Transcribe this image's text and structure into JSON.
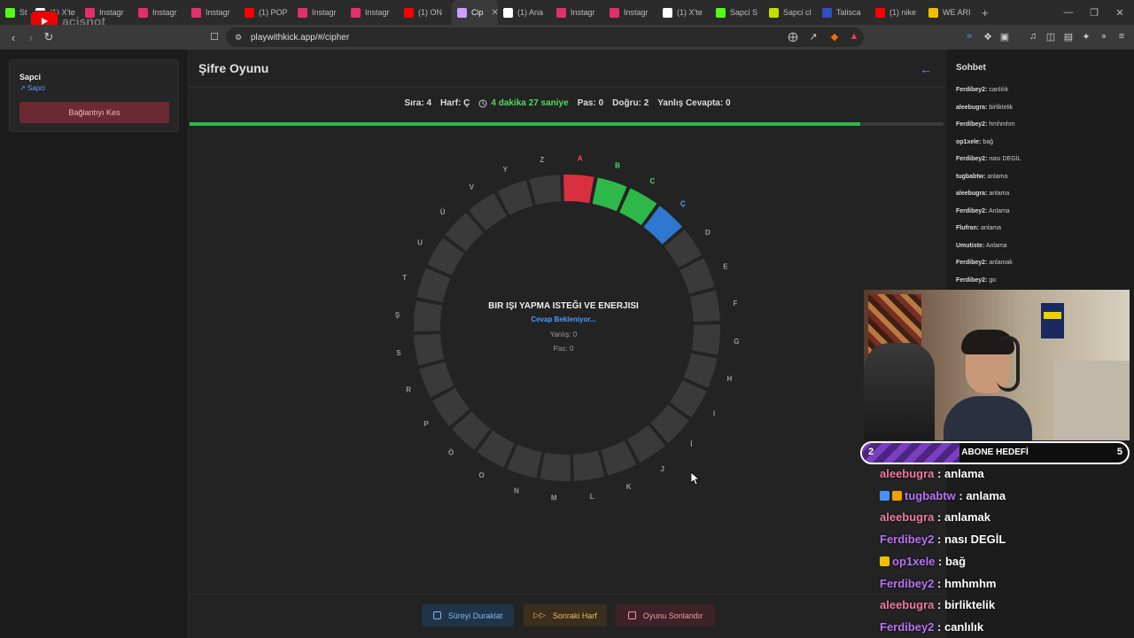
{
  "tabs": [
    {
      "label": "St",
      "icon": "kick-icon",
      "color": "#53fc18",
      "active": false
    },
    {
      "label": "(1) X'te",
      "icon": "x-icon",
      "color": "#ffffff",
      "active": false
    },
    {
      "label": "Instagr",
      "icon": "instagram-icon",
      "color": "#e1306c",
      "active": false
    },
    {
      "label": "Instagr",
      "icon": "instagram-icon",
      "color": "#e1306c",
      "active": false
    },
    {
      "label": "Instagr",
      "icon": "instagram-icon",
      "color": "#e1306c",
      "active": false
    },
    {
      "label": "(1) POP",
      "icon": "youtube-icon",
      "color": "#ff0000",
      "active": false
    },
    {
      "label": "Instagr",
      "icon": "instagram-icon",
      "color": "#e1306c",
      "active": false
    },
    {
      "label": "Instagr",
      "icon": "instagram-icon",
      "color": "#e1306c",
      "active": false
    },
    {
      "label": "(1) ON",
      "icon": "youtube-icon",
      "color": "#ff0000",
      "active": false
    },
    {
      "label": "Cip",
      "icon": "cipher-icon",
      "color": "#c9a0ff",
      "active": true
    },
    {
      "label": "(1) Ana",
      "icon": "x-icon",
      "color": "#ffffff",
      "active": false
    },
    {
      "label": "Instagr",
      "icon": "instagram-icon",
      "color": "#e1306c",
      "active": false
    },
    {
      "label": "Instagr",
      "icon": "instagram-icon",
      "color": "#e1306c",
      "active": false
    },
    {
      "label": "(1) X'te",
      "icon": "x-icon",
      "color": "#ffffff",
      "active": false
    },
    {
      "label": "Sapci S",
      "icon": "kick-icon",
      "color": "#53fc18",
      "active": false
    },
    {
      "label": "Sapci cl",
      "icon": "kick-icon",
      "color": "#c0e000",
      "active": false
    },
    {
      "label": "Talisca",
      "icon": "flag-icon",
      "color": "#3050c0",
      "active": false
    },
    {
      "label": "(1) nike",
      "icon": "youtube-icon",
      "color": "#ff0000",
      "active": false
    },
    {
      "label": "WE ARI",
      "icon": "crown-icon",
      "color": "#f0c000",
      "active": false
    }
  ],
  "watermark": "acisnot",
  "url": "playwithkick.app/#/cipher",
  "sidebar": {
    "user_name": "Sapci",
    "user_sub": "↗ Sapci",
    "disconnect_label": "Bağlantıyı Kes"
  },
  "game": {
    "title": "Şifre Oyunu",
    "stats": {
      "turn": "Sıra: 4",
      "letter": "Harf: Ç",
      "time": "4 dakika 27 saniye",
      "pass": "Pas: 0",
      "correct": "Doğru: 2",
      "wrong_answer": "Yanlış Cevapta: 0"
    },
    "progress": 0.89,
    "center": {
      "question": "BIR IŞI YAPMA ISTEĞI VE ENERJISI",
      "status": "Cevap Bekleniyor...",
      "wrong": "Yanlış: 0",
      "pass": "Pas: 0"
    },
    "letters": [
      "A",
      "B",
      "C",
      "Ç",
      "D",
      "E",
      "F",
      "G",
      "H",
      "I",
      "İ",
      "J",
      "K",
      "L",
      "M",
      "N",
      "O",
      "Ö",
      "P",
      "R",
      "S",
      "Ş",
      "T",
      "U",
      "Ü",
      "V",
      "Y",
      "Z"
    ],
    "letter_states": [
      "wrong",
      "correct",
      "correct",
      "current",
      "none",
      "none",
      "none",
      "none",
      "none",
      "none",
      "none",
      "none",
      "none",
      "none",
      "none",
      "none",
      "none",
      "none",
      "none",
      "none",
      "none",
      "none",
      "none",
      "none",
      "none",
      "none",
      "none",
      "none"
    ],
    "colors": {
      "wrong": "#d9303f",
      "correct": "#2fb84a",
      "current": "#2f78d0",
      "none": "#3a3a3a"
    },
    "buttons": {
      "pause": "Süreyi Duraklat",
      "next": "Sonraki Harf",
      "end": "Oyunu Sonlandır"
    }
  },
  "chat": {
    "title": "Sohbet",
    "messages": [
      {
        "user": "Ferdibey2:",
        "text": "canlılık"
      },
      {
        "user": "aleebugra:",
        "text": "birliktelik"
      },
      {
        "user": "Ferdibey2:",
        "text": "hmhmhm"
      },
      {
        "user": "op1xele:",
        "text": "bağ"
      },
      {
        "user": "Ferdibey2:",
        "text": "nası DEGİL"
      },
      {
        "user": "tugbabtw:",
        "text": "anlama"
      },
      {
        "user": "aleebugra:",
        "text": "anlama"
      },
      {
        "user": "Ferdibey2:",
        "text": "Anlama"
      },
      {
        "user": "Flufran:",
        "text": "anlama"
      },
      {
        "user": "Umutiste:",
        "text": "Anlama"
      },
      {
        "user": "Ferdibey2:",
        "text": "anlamak"
      },
      {
        "user": "Ferdibey2:",
        "text": "go"
      }
    ]
  },
  "overlay": {
    "goal_left": "2",
    "goal_label": "ABONE HEDEFİ",
    "goal_right": "5",
    "messages": [
      {
        "user": "aleebugra",
        "text": " : anlama",
        "color": "pink",
        "badges": []
      },
      {
        "user": "tugbabtw",
        "text": " : anlama",
        "color": "purple",
        "badges": [
          "#4a8fff",
          "#f0a000"
        ]
      },
      {
        "user": "aleebugra",
        "text": " : anlamak",
        "color": "pink",
        "badges": []
      },
      {
        "user": "Ferdibey2",
        "text": " : nası DEGİL",
        "color": "purple",
        "badges": []
      },
      {
        "user": "op1xele",
        "text": " : bağ",
        "color": "purple",
        "badges": [
          "#f0c000"
        ]
      },
      {
        "user": "Ferdibey2",
        "text": " : hmhmhm",
        "color": "purple",
        "badges": []
      },
      {
        "user": "aleebugra",
        "text": " : birliktelik",
        "color": "pink",
        "badges": []
      },
      {
        "user": "Ferdibey2",
        "text": " : canlılık",
        "color": "purple",
        "badges": []
      }
    ]
  }
}
